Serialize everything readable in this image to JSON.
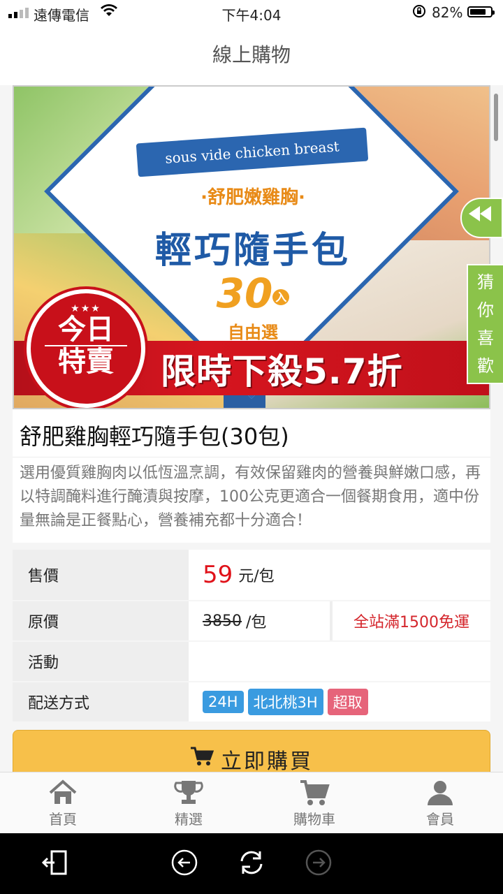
{
  "status_bar": {
    "carrier": "遠傳電信",
    "time": "下午4:04",
    "battery_percent": "82%",
    "battery_level": 0.82
  },
  "header": {
    "title": "線上購物"
  },
  "banner": {
    "ribbon": "sous vide chicken breast",
    "subtitle": "·舒肥嫩雞胸·",
    "headline": "輕巧隨手包",
    "count": "30",
    "count_unit": "入",
    "free_choice": "自由選",
    "badge_line1": "今日",
    "badge_line2": "特賣",
    "badge_stars": "★★★",
    "sale_text": "限時下殺5.7折"
  },
  "product": {
    "title": "舒肥雞胸輕巧隨手包(30包)",
    "description": "選用優質雞胸肉以低恆溫烹調，有效保留雞肉的營養與鮮嫩口感，再以特調醃料進行醃漬與按摩，100公克更適合一個餐期食用，適中份量無論是正餐點心，營養補充都十分適合！"
  },
  "info": {
    "price_label": "售價",
    "price_value": "59",
    "price_unit": "元/包",
    "orig_label": "原價",
    "orig_value": "3850",
    "orig_unit": "/包",
    "shipping_promo": "全站滿1500免運",
    "activity_label": "活動",
    "delivery_label": "配送方式",
    "delivery_tags": [
      "24H",
      "北北桃3H",
      "超取"
    ]
  },
  "buy_button": {
    "label": "立即購買",
    "icon": "cart-icon"
  },
  "side": {
    "share_icon": "rewind-icon",
    "guess_text": [
      "猜",
      "你",
      "喜",
      "歡"
    ]
  },
  "tabbar": {
    "items": [
      {
        "label": "首頁",
        "icon": "home-icon"
      },
      {
        "label": "精選",
        "icon": "trophy-icon"
      },
      {
        "label": "購物車",
        "icon": "cart-icon"
      },
      {
        "label": "會員",
        "icon": "user-icon"
      }
    ]
  },
  "colors": {
    "price_red": "#e0121a",
    "buy_yellow": "#f7c04a",
    "tag_blue": "#3a9be0",
    "tag_pink": "#e6647a",
    "side_green": "#8bc34a"
  }
}
